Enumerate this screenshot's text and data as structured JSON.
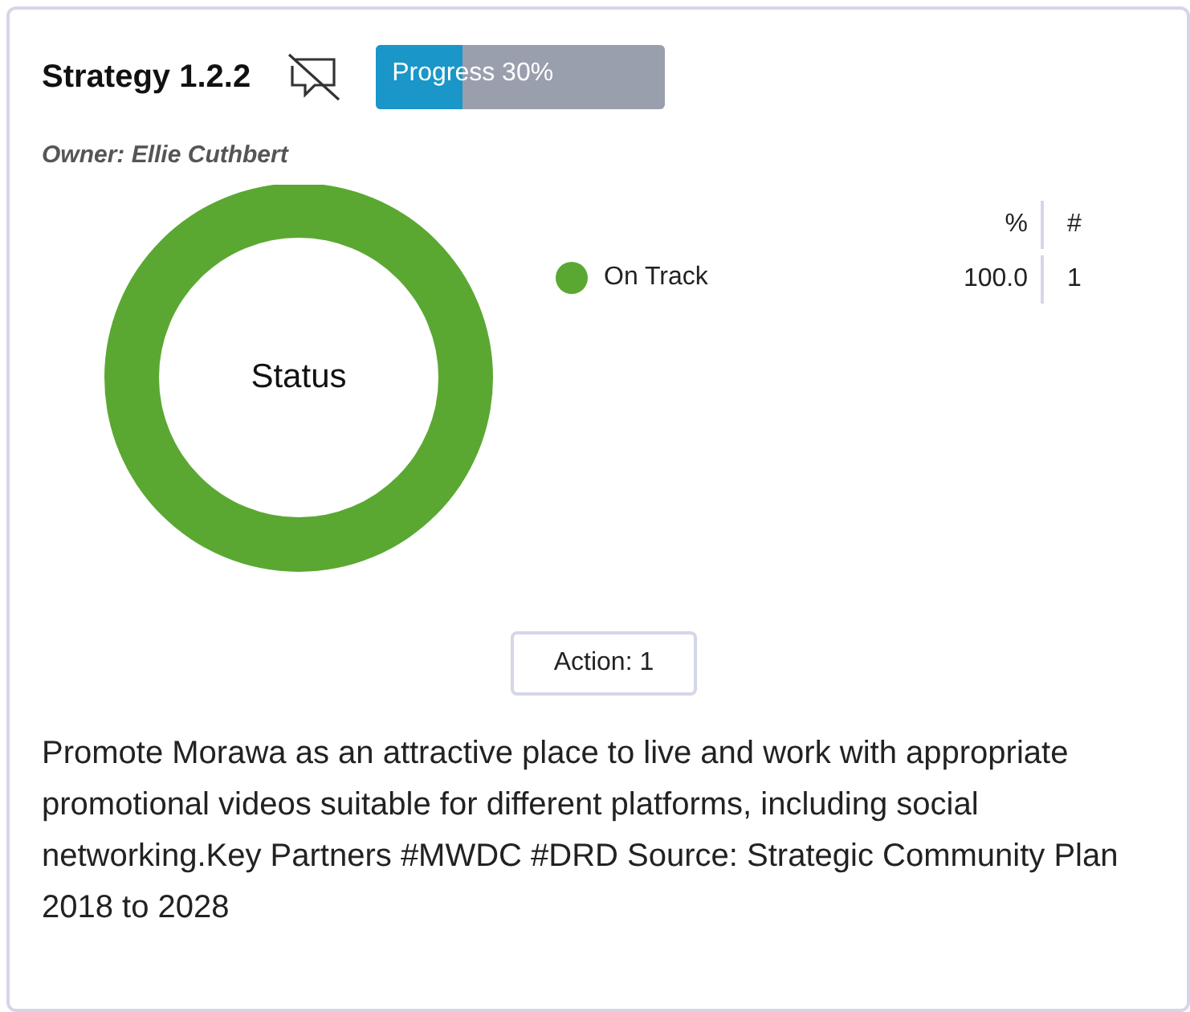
{
  "card": {
    "title": "Strategy 1.2.2",
    "comments_disabled": true,
    "progress": {
      "label": "Progress 30%",
      "level": 0.3
    },
    "owner": "Owner: Ellie Cuthbert",
    "status": {
      "title": "Status",
      "legend": {
        "columns": [
          "%",
          "#"
        ],
        "rows": [
          {
            "name": "On Track",
            "color": "#5aa832",
            "percent": "100.0",
            "count": "1"
          }
        ]
      }
    },
    "action_button": "Action: 1",
    "description": "Promote Morawa as an attractive place to live and work with appropriate promotional videos suitable for different platforms, including social networking.Key Partners #MWDC #DRD Source: Strategic Community Plan 2018 to 2028"
  }
}
